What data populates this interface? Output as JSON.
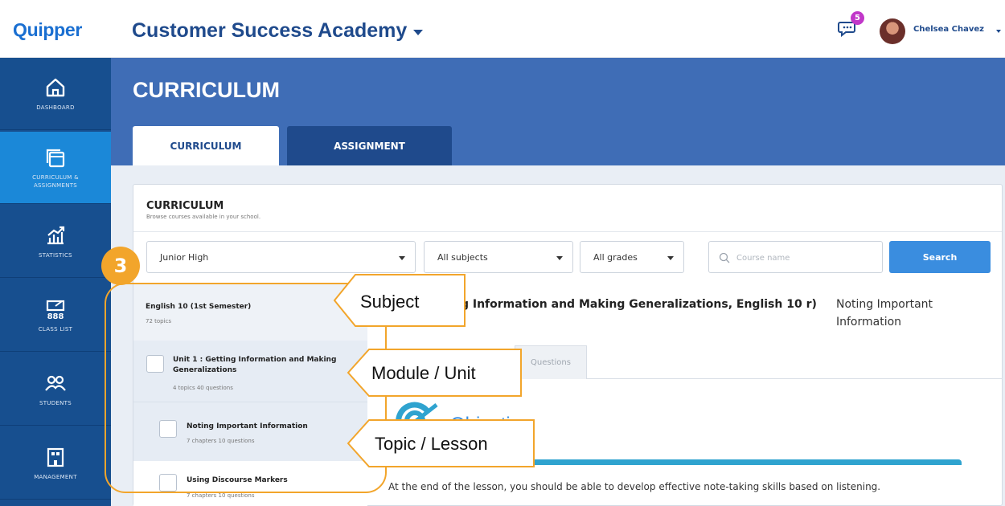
{
  "brand": "Quipper",
  "school": "Customer Success Academy",
  "notifications": "5",
  "user": {
    "name": "Chelsea Chavez"
  },
  "colors": {
    "brand_blue": "#1a6fd1",
    "sidebar": "#174f8f",
    "header_band": "#3f6db6",
    "annotation": "#f2a52b",
    "search_button": "#3a8ddf"
  },
  "sidebar": {
    "items": [
      {
        "label": "DASHBOARD",
        "icon": "home-icon"
      },
      {
        "label": "CURRICULUM & ASSIGNMENTS",
        "icon": "curriculum-icon",
        "active": true
      },
      {
        "label": "STATISTICS",
        "icon": "chart-icon"
      },
      {
        "label": "CLASS LIST",
        "icon": "class-list-icon"
      },
      {
        "label": "STUDENTS",
        "icon": "students-icon"
      },
      {
        "label": "MANAGEMENT",
        "icon": "management-icon"
      }
    ]
  },
  "page_title": "CURRICULUM",
  "tabs": [
    {
      "label": "CURRICULUM",
      "active": true
    },
    {
      "label": "ASSIGNMENT",
      "active": false
    }
  ],
  "card": {
    "title": "CURRICULUM",
    "subtitle": "Browse courses available in your school."
  },
  "filters": {
    "level": "Junior High",
    "subject": "All subjects",
    "grade": "All grades",
    "search_placeholder": "Course name",
    "search_button": "Search"
  },
  "tree": {
    "subject": {
      "title": "English 10 (1st Semester)",
      "meta": "72 topics"
    },
    "unit": {
      "title": "Unit 1 : Getting Information and Making Generalizations",
      "meta": "4 topics   40 questions"
    },
    "topic": {
      "title": "Noting Important Information",
      "meta": "7 chapters   10 questions"
    },
    "topic2": {
      "title": "Using Discourse Markers",
      "meta": "7 chapters   10 questions"
    }
  },
  "detail": {
    "title": "ng Information and Making Generalizations, English 10 r)",
    "topic": "Noting Important Information",
    "tab": "Questions",
    "objective": "Objective",
    "description": "At the end of the lesson, you should be able to develop effective note-taking skills based on listening."
  },
  "annotation": {
    "step": "3",
    "labels": [
      "Subject",
      "Module / Unit",
      "Topic / Lesson"
    ]
  }
}
